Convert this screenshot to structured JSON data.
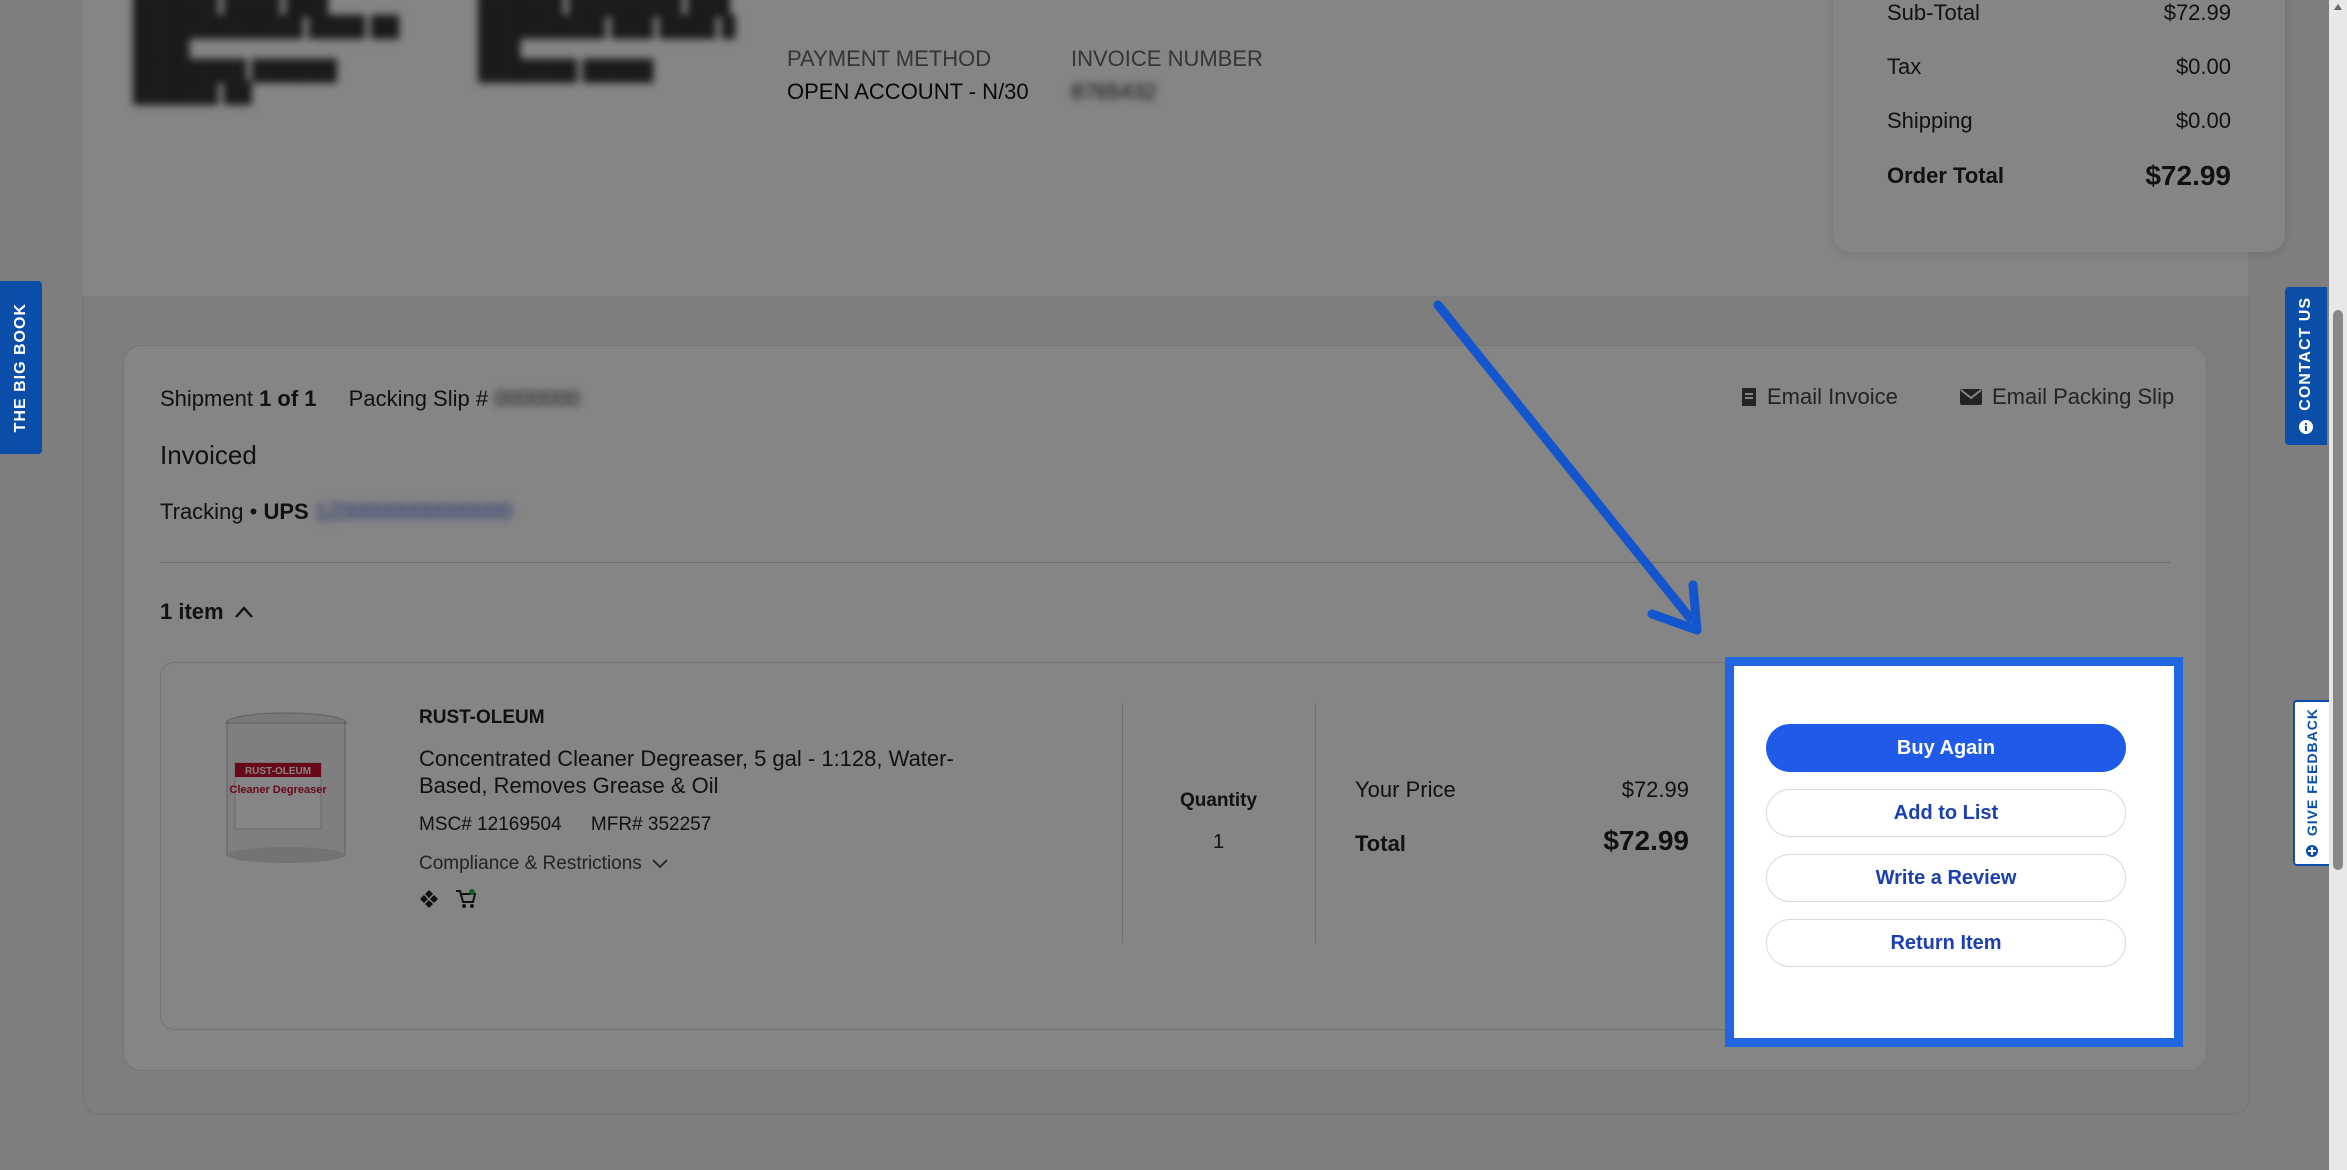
{
  "order": {
    "payment_method_label": "PAYMENT METHOD",
    "payment_method_value": "OPEN ACCOUNT - N/30",
    "invoice_number_label": "INVOICE NUMBER",
    "invoice_number_value": "8765432"
  },
  "summary": {
    "subtotal_label": "Sub-Total",
    "subtotal_value": "$72.99",
    "tax_label": "Tax",
    "tax_value": "$0.00",
    "shipping_label": "Shipping",
    "shipping_value": "$0.00",
    "order_total_label": "Order Total",
    "order_total_value": "$72.99"
  },
  "shipment": {
    "shipment_prefix": "Shipment",
    "shipment_count": "1 of 1",
    "packing_slip_label": "Packing Slip #",
    "packing_slip_value": "0000000",
    "status": "Invoiced",
    "tracking_label": "Tracking",
    "carrier": "UPS",
    "tracking_value": "1Z00000000000000",
    "email_invoice": "Email Invoice",
    "email_packing_slip": "Email Packing Slip",
    "items_toggle": "1 item"
  },
  "item": {
    "brand": "RUST-OLEUM",
    "title": "Concentrated Cleaner Degreaser, 5 gal - 1:128, Water-Based, Removes Grease & Oil",
    "msc": "MSC# 12169504",
    "mfr": "MFR# 352257",
    "compliance": "Compliance & Restrictions",
    "quantity_label": "Quantity",
    "quantity_value": "1",
    "your_price_label": "Your Price",
    "your_price_value": "$72.99",
    "total_label": "Total",
    "total_value": "$72.99",
    "product_label_brand": "RUST-OLEUM",
    "product_label_name": "Cleaner Degreaser"
  },
  "actions": {
    "buy_again": "Buy Again",
    "add_to_list": "Add to List",
    "write_review": "Write a Review",
    "return_item": "Return Item"
  },
  "side_tabs": {
    "big_book": "THE BIG BOOK",
    "contact_us": "CONTACT US",
    "give_feedback": "GIVE FEEDBACK"
  },
  "colors": {
    "accent": "#1f5be8",
    "highlight_border": "#1f66e0",
    "side_tab": "#0b4ea9"
  }
}
